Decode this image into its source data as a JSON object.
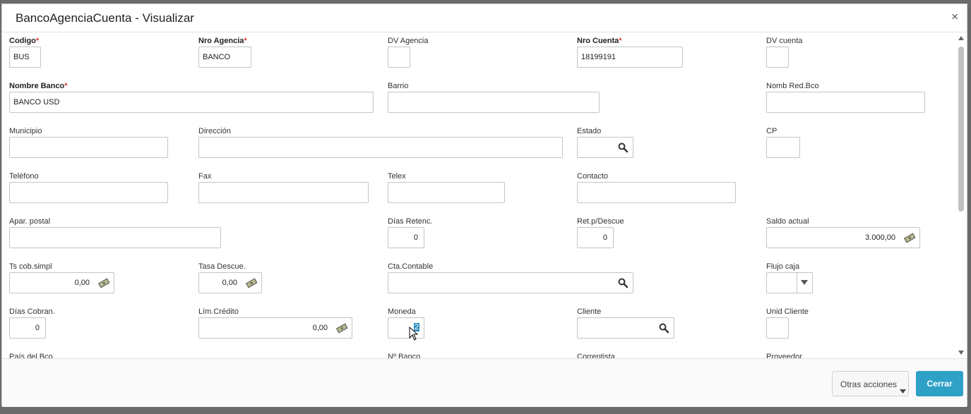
{
  "window": {
    "title": "BancoAgenciaCuenta - Visualizar",
    "close_glyph": "×"
  },
  "fields": [
    {
      "id": "codigo",
      "label": "Codigo",
      "required": true,
      "value": "BUS"
    },
    {
      "id": "nro_agencia",
      "label": "Nro Agencia",
      "required": true,
      "value": "BANCO"
    },
    {
      "id": "dv_agencia",
      "label": "DV Agencia",
      "required": false,
      "value": ""
    },
    {
      "id": "nro_cuenta",
      "label": "Nro Cuenta",
      "required": true,
      "value": "18199191"
    },
    {
      "id": "dv_cuenta",
      "label": "DV cuenta",
      "required": false,
      "value": ""
    },
    {
      "id": "nombre_banco",
      "label": "Nombre Banco",
      "required": true,
      "value": "BANCO USD"
    },
    {
      "id": "barrio",
      "label": "Barrio",
      "required": false,
      "value": ""
    },
    {
      "id": "nomb_red_bco",
      "label": "Nomb Red.Bco",
      "required": false,
      "value": ""
    },
    {
      "id": "municipio",
      "label": "Municipio",
      "required": false,
      "value": ""
    },
    {
      "id": "direccion",
      "label": "Dirección",
      "required": false,
      "value": ""
    },
    {
      "id": "estado",
      "label": "Estado",
      "required": false,
      "value": "",
      "icon": "search-icon"
    },
    {
      "id": "cp",
      "label": "CP",
      "required": false,
      "value": ""
    },
    {
      "id": "telefono",
      "label": "Teléfono",
      "required": false,
      "value": ""
    },
    {
      "id": "fax",
      "label": "Fax",
      "required": false,
      "value": ""
    },
    {
      "id": "telex",
      "label": "Telex",
      "required": false,
      "value": ""
    },
    {
      "id": "contacto",
      "label": "Contacto",
      "required": false,
      "value": ""
    },
    {
      "id": "apar_postal",
      "label": "Apar. postal",
      "required": false,
      "value": ""
    },
    {
      "id": "dias_retenc",
      "label": "Días Retenc.",
      "required": false,
      "value": "0"
    },
    {
      "id": "ret_p_descue",
      "label": "Ret.p/Descue",
      "required": false,
      "value": "0"
    },
    {
      "id": "saldo_actual",
      "label": "Saldo actual",
      "required": false,
      "value": "3.000,00",
      "icon": "money-icon"
    },
    {
      "id": "ts_cob_simpl",
      "label": "Ts cob.simpl",
      "required": false,
      "value": "0,00",
      "icon": "money-icon"
    },
    {
      "id": "tasa_descue",
      "label": "Tasa Descue.",
      "required": false,
      "value": "0,00",
      "icon": "money-icon"
    },
    {
      "id": "cta_contable",
      "label": "Cta.Contable",
      "required": false,
      "value": "",
      "icon": "search-icon"
    },
    {
      "id": "flujo_caja",
      "label": "Flujo caja",
      "required": false,
      "value": "",
      "icon": "chevron-down-icon"
    },
    {
      "id": "dias_cobran",
      "label": "Días Cobran.",
      "required": false,
      "value": "0"
    },
    {
      "id": "lim_credito",
      "label": "Lím.Crédito",
      "required": false,
      "value": "0,00",
      "icon": "money-icon"
    },
    {
      "id": "moneda",
      "label": "Moneda",
      "required": false,
      "value": "2"
    },
    {
      "id": "cliente",
      "label": "Cliente",
      "required": false,
      "value": "",
      "icon": "search-icon"
    },
    {
      "id": "unid_cliente",
      "label": "Unid Cliente",
      "required": false,
      "value": ""
    },
    {
      "id": "pais_del_bco",
      "label": "País del Bco.",
      "required": false,
      "value": ""
    },
    {
      "id": "n_banco",
      "label": "Nº Banco",
      "required": false,
      "value": ""
    },
    {
      "id": "correntista",
      "label": "Correntista",
      "required": false,
      "value": ""
    },
    {
      "id": "proveedor",
      "label": "Proveedor",
      "required": false,
      "value": ""
    }
  ],
  "footer": {
    "more_label": "Otras acciones",
    "close_label": "Cerrar"
  },
  "colors": {
    "accent": "#2fa1c7",
    "required_asterisk": "#e03c3c",
    "selection": "#2f8fbf"
  }
}
